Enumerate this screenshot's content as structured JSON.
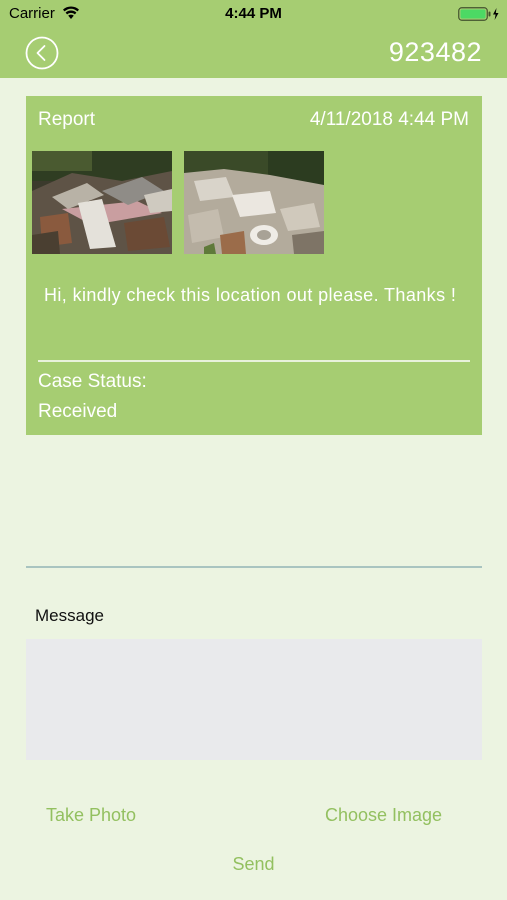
{
  "status_bar": {
    "carrier": "Carrier",
    "time": "4:44 PM"
  },
  "nav": {
    "title": "923482"
  },
  "report": {
    "label": "Report",
    "date": "4/11/2018 4:44 PM",
    "message": "Hi, kindly check this location out please. Thanks !",
    "case_status_label": "Case Status:",
    "case_status_value": "Received"
  },
  "message_section": {
    "label": "Message",
    "value": ""
  },
  "actions": {
    "take_photo": "Take Photo",
    "choose_image": "Choose Image",
    "send": "Send"
  },
  "colors": {
    "accent": "#a6cd72",
    "background": "#ecf4e1",
    "action_text": "#93c060"
  }
}
